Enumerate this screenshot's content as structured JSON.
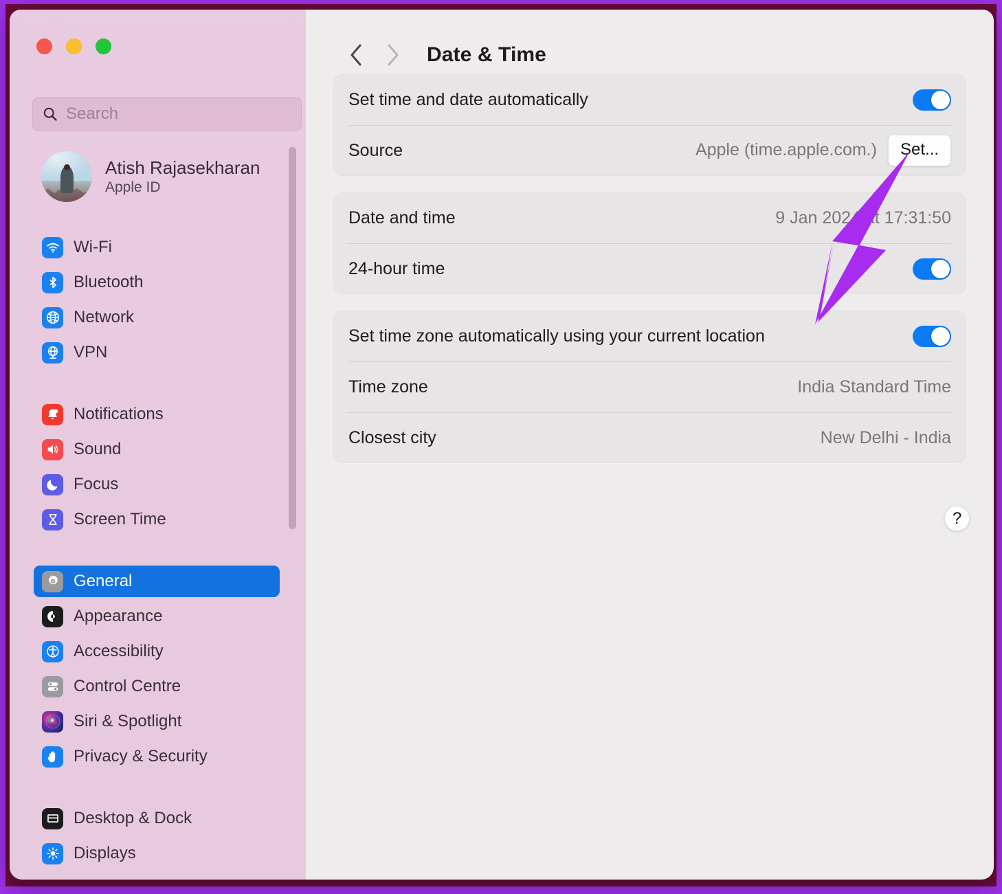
{
  "window": {
    "traffic_lights": [
      {
        "name": "close",
        "color": "#F9564E"
      },
      {
        "name": "minimize",
        "color": "#FCC02E"
      },
      {
        "name": "zoom",
        "color": "#22C63A"
      }
    ]
  },
  "sidebar": {
    "search": {
      "placeholder": "Search",
      "value": "",
      "icon": "search-icon"
    },
    "account": {
      "name": "Atish Rajasekharan",
      "subtitle": "Apple ID",
      "avatar": "user-avatar-photo"
    },
    "groups": [
      {
        "items": [
          {
            "label": "Wi-Fi",
            "icon": "wifi-icon",
            "color": "#1A82F0",
            "selected": false
          },
          {
            "label": "Bluetooth",
            "icon": "bluetooth-icon",
            "color": "#1A82F0",
            "selected": false
          },
          {
            "label": "Network",
            "icon": "network-icon",
            "color": "#1A82F0",
            "selected": false
          },
          {
            "label": "VPN",
            "icon": "vpn-icon",
            "color": "#1A82F0",
            "selected": false
          }
        ]
      },
      {
        "items": [
          {
            "label": "Notifications",
            "icon": "bell-icon",
            "color": "#F2392E",
            "selected": false
          },
          {
            "label": "Sound",
            "icon": "speaker-icon",
            "color": "#F54B50",
            "selected": false
          },
          {
            "label": "Focus",
            "icon": "moon-icon",
            "color": "#5E5CE6",
            "selected": false
          },
          {
            "label": "Screen Time",
            "icon": "hourglass-icon",
            "color": "#5E5CE6",
            "selected": false
          }
        ]
      },
      {
        "items": [
          {
            "label": "General",
            "icon": "gear-icon",
            "color": "#8E8E93",
            "selected": true
          },
          {
            "label": "Appearance",
            "icon": "appearance-icon",
            "color": "#1C1C1E",
            "selected": false
          },
          {
            "label": "Accessibility",
            "icon": "accessibility-icon",
            "color": "#1A82F0",
            "selected": false
          },
          {
            "label": "Control Centre",
            "icon": "control-centre-icon",
            "color": "#8E8E93",
            "selected": false
          },
          {
            "label": "Siri & Spotlight",
            "icon": "siri-icon",
            "color": "#2B2140",
            "selected": false
          },
          {
            "label": "Privacy & Security",
            "icon": "hand-icon",
            "color": "#1A82F0",
            "selected": false
          }
        ]
      },
      {
        "items": [
          {
            "label": "Desktop & Dock",
            "icon": "desktop-dock-icon",
            "color": "#1C1C1E",
            "selected": false
          },
          {
            "label": "Displays",
            "icon": "displays-icon",
            "color": "#1A82F0",
            "selected": false
          }
        ]
      }
    ]
  },
  "header": {
    "back_icon": "chevron-left-icon",
    "forward_icon": "chevron-right-icon",
    "title": "Date & Time"
  },
  "main": {
    "cards": [
      {
        "rows": [
          {
            "label": "Set time and date automatically",
            "control": "toggle",
            "value": "on"
          },
          {
            "label": "Source",
            "value": "Apple (time.apple.com.)",
            "control": "button",
            "button_label": "Set..."
          }
        ]
      },
      {
        "rows": [
          {
            "label": "Date and time",
            "value": "9 Jan 2024 at 17:31:50",
            "control": "text"
          },
          {
            "label": "24-hour time",
            "control": "toggle",
            "value": "on"
          }
        ]
      },
      {
        "rows": [
          {
            "label": "Set time zone automatically using your current location",
            "control": "toggle",
            "value": "on"
          },
          {
            "label": "Time zone",
            "value": "India Standard Time",
            "control": "text"
          },
          {
            "label": "Closest city",
            "value": "New Delhi - India",
            "control": "text"
          }
        ]
      }
    ],
    "help_button": {
      "label": "?",
      "icon": "question-mark-icon"
    }
  },
  "annotation": {
    "arrow_color": "#A82BF0",
    "points_to": "Set..."
  },
  "colors": {
    "accent_toggle": "#0A7BF5",
    "selection": "#1372E0",
    "sidebar_bg": "#E7CADE",
    "content_bg": "#EFECEE",
    "card_bg": "#E8E5E7",
    "frame_outer": "#9B31E8",
    "frame_inner": "#6A0B38"
  }
}
